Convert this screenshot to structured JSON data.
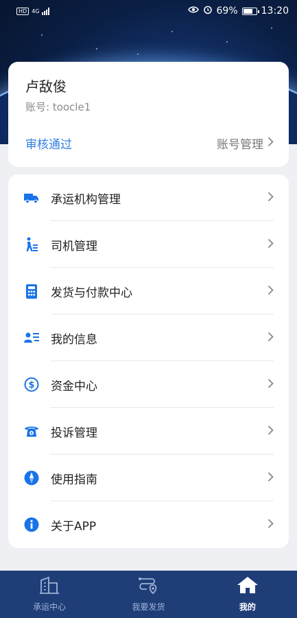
{
  "status_bar": {
    "net_label": "HD",
    "net_type": "4G",
    "battery": "69%",
    "time": "13:20"
  },
  "user": {
    "name": "卢敌俊",
    "account": "账号: toocle1",
    "status": "审核通过",
    "manage_label": "账号管理"
  },
  "menu": {
    "items": [
      {
        "label": "承运机构管理",
        "icon": "truck-icon"
      },
      {
        "label": "司机管理",
        "icon": "driver-icon"
      },
      {
        "label": "发货与付款中心",
        "icon": "calculator-icon"
      },
      {
        "label": "我的信息",
        "icon": "profile-card-icon"
      },
      {
        "label": "资金中心",
        "icon": "dollar-icon"
      },
      {
        "label": "投诉管理",
        "icon": "telephone-icon"
      },
      {
        "label": "使用指南",
        "icon": "compass-icon"
      },
      {
        "label": "关于APP",
        "icon": "info-icon"
      }
    ]
  },
  "tabbar": {
    "tabs": [
      {
        "label": "承运中心",
        "icon": "building-icon",
        "active": false
      },
      {
        "label": "我要发货",
        "icon": "route-pin-icon",
        "active": false
      },
      {
        "label": "我的",
        "icon": "home-icon",
        "active": true
      }
    ]
  },
  "colors": {
    "accent": "#2f7fe0",
    "icon_blue": "#1a73e8",
    "tabbar_bg": "#1f3e78",
    "page_bg": "#eef0f4"
  }
}
